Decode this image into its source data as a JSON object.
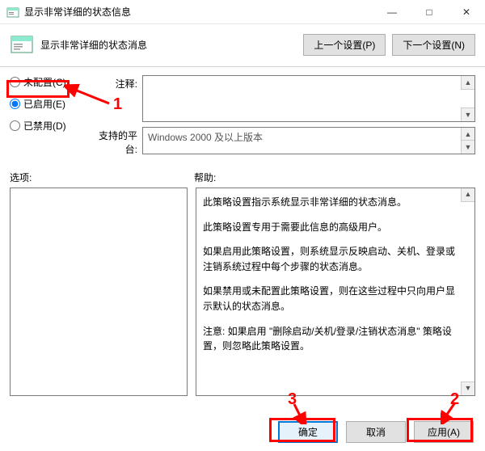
{
  "window": {
    "title": "显示非常详细的状态信息",
    "min": "—",
    "max": "□",
    "close": "✕"
  },
  "header": {
    "setting_name": "显示非常详细的状态消息",
    "prev_btn": "上一个设置(P)",
    "next_btn": "下一个设置(N)"
  },
  "radios": {
    "not_configured": "未配置(C)",
    "enabled": "已启用(E)",
    "disabled": "已禁用(D)"
  },
  "fields": {
    "comment_label": "注释:",
    "platform_label": "支持的平台:",
    "platform_value": "Windows 2000 及以上版本"
  },
  "mid": {
    "options_label": "选项:",
    "help_label": "帮助:"
  },
  "help": {
    "p1": "此策略设置指示系统显示非常详细的状态消息。",
    "p2": "此策略设置专用于需要此信息的高级用户。",
    "p3": "如果启用此策略设置，则系统显示反映启动、关机、登录或注销系统过程中每个步骤的状态消息。",
    "p4": "如果禁用或未配置此策略设置，则在这些过程中只向用户显示默认的状态消息。",
    "p5": "注意: 如果启用 \"删除启动/关机/登录/注销状态消息\" 策略设置，则忽略此策略设置。"
  },
  "buttons": {
    "ok": "确定",
    "cancel": "取消",
    "apply": "应用(A)"
  },
  "annotations": {
    "n1": "1",
    "n2": "2",
    "n3": "3"
  }
}
